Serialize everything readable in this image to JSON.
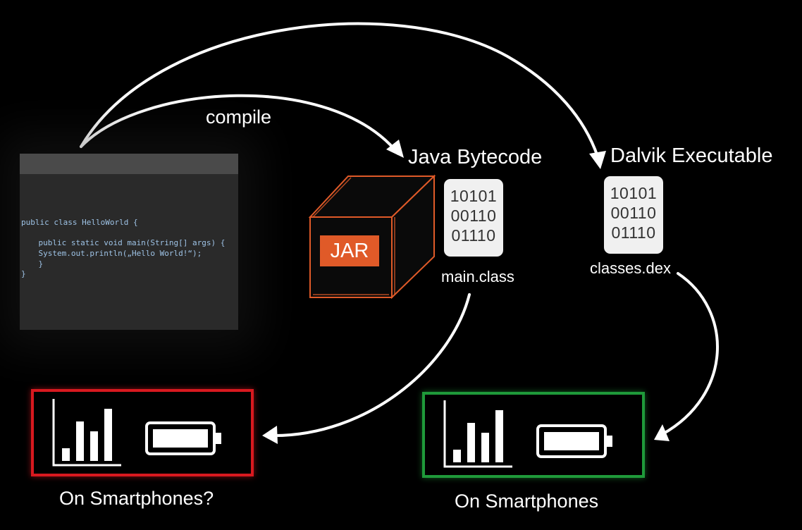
{
  "code": {
    "lines": [
      "public class HelloWorld {",
      "",
      "    public static void main(String[] args) {",
      "    System.out.println(„Hello World!“);",
      "    }",
      "}"
    ]
  },
  "labels": {
    "compile": "compile",
    "java_bytecode": "Java Bytecode",
    "dalvik_executable": "Dalvik Executable",
    "main_class": "main.class",
    "classes_dex": "classes.dex",
    "jar": "JAR",
    "on_smartphones_question": "On Smartphones?",
    "on_smartphones": "On Smartphones"
  },
  "binary": {
    "main_class": [
      "10101",
      "00110",
      "01110"
    ],
    "classes_dex": [
      "10101",
      "00110",
      "01110"
    ]
  },
  "colors": {
    "jar_accent": "#e05a28",
    "bad_border": "#d8191f",
    "good_border": "#1f9a3a",
    "arrow": "#ffffff"
  },
  "icons": {
    "jar_box": "cube-icon",
    "chart": "bar-chart-icon",
    "battery": "battery-icon"
  }
}
